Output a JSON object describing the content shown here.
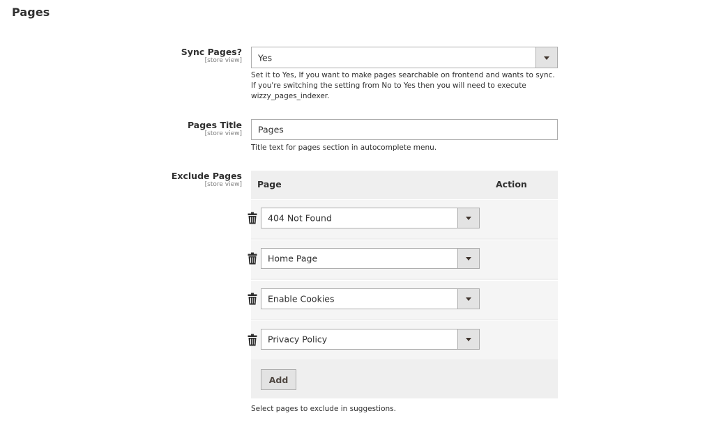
{
  "section": {
    "title": "Pages"
  },
  "fields": {
    "sync_pages": {
      "label": "Sync Pages?",
      "scope": "[store view]",
      "value": "Yes",
      "note": "Set it to Yes, If you want to make pages searchable on frontend and wants to sync. If you're switching the setting from No to Yes then you will need to execute wizzy_pages_indexer."
    },
    "pages_title": {
      "label": "Pages Title",
      "scope": "[store view]",
      "value": "Pages",
      "note": "Title text for pages section in autocomplete menu."
    },
    "exclude_pages": {
      "label": "Exclude Pages",
      "scope": "[store view]",
      "columns": {
        "page": "Page",
        "action": "Action"
      },
      "rows": [
        {
          "page": "404 Not Found"
        },
        {
          "page": "Home Page"
        },
        {
          "page": "Enable Cookies"
        },
        {
          "page": "Privacy Policy"
        }
      ],
      "add_label": "Add",
      "note": "Select pages to exclude in suggestions."
    }
  },
  "icons": {
    "dropdown": "chevron-down-icon",
    "delete": "trash-icon"
  },
  "colors": {
    "grid_bg": "#efefef",
    "row_bg": "#f5f5f5",
    "button_bg": "#e3e3e3",
    "border": "#adadad"
  }
}
